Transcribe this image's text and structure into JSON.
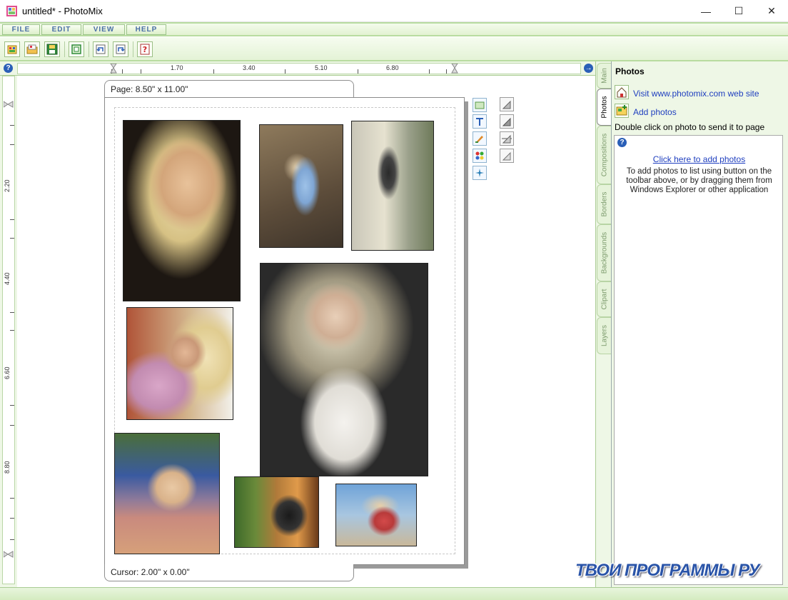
{
  "window": {
    "title": "untitled* - PhotoMix",
    "minimize_glyph": "—",
    "maximize_glyph": "☐",
    "close_glyph": "✕"
  },
  "menu": {
    "items": [
      {
        "label": "FILE"
      },
      {
        "label": "EDIT"
      },
      {
        "label": "VIEW"
      },
      {
        "label": "HELP"
      }
    ]
  },
  "toolbar": {
    "icons": [
      "new-icon",
      "open-icon",
      "save-icon",
      "page-icon",
      "undo-icon",
      "redo-icon",
      "help-icon"
    ]
  },
  "ruler": {
    "h_labels": [
      "1.70",
      "3.40",
      "5.10",
      "6.80"
    ],
    "v_labels": [
      "2.20",
      "4.40",
      "6.60",
      "8.80"
    ],
    "help_glyph": "?",
    "nav_glyph": "→"
  },
  "canvas": {
    "page_size_label": "Page: 8.50\" x 11.00\"",
    "cursor_label": "Cursor: 2.00\" x 0.00\"",
    "side_tools": [
      "image-tool-icon",
      "text-tool-icon",
      "paint-tool-icon",
      "color-tool-icon",
      "effects-tool-icon"
    ],
    "align_tools": [
      "align-top-icon",
      "align-up-icon",
      "align-middle-icon",
      "align-bottom-icon"
    ]
  },
  "panel_tabs": [
    {
      "label": "Main"
    },
    {
      "label": "Photos"
    },
    {
      "label": "Compositions"
    },
    {
      "label": "Borders"
    },
    {
      "label": "Backgrounds"
    },
    {
      "label": "Clipart"
    },
    {
      "label": "Layers"
    }
  ],
  "photos_panel": {
    "title": "Photos",
    "visit_link": "Visit www.photomix.com web site",
    "add_photos": "Add photos",
    "hint": "Double click on photo to send it to page",
    "click_here": "Click here to add photos",
    "description": "To add photos to list using button on the toolbar above, or by dragging them from Windows Explorer or other application"
  },
  "watermark": "ТВОИ ПРОГРАММЫ РУ"
}
